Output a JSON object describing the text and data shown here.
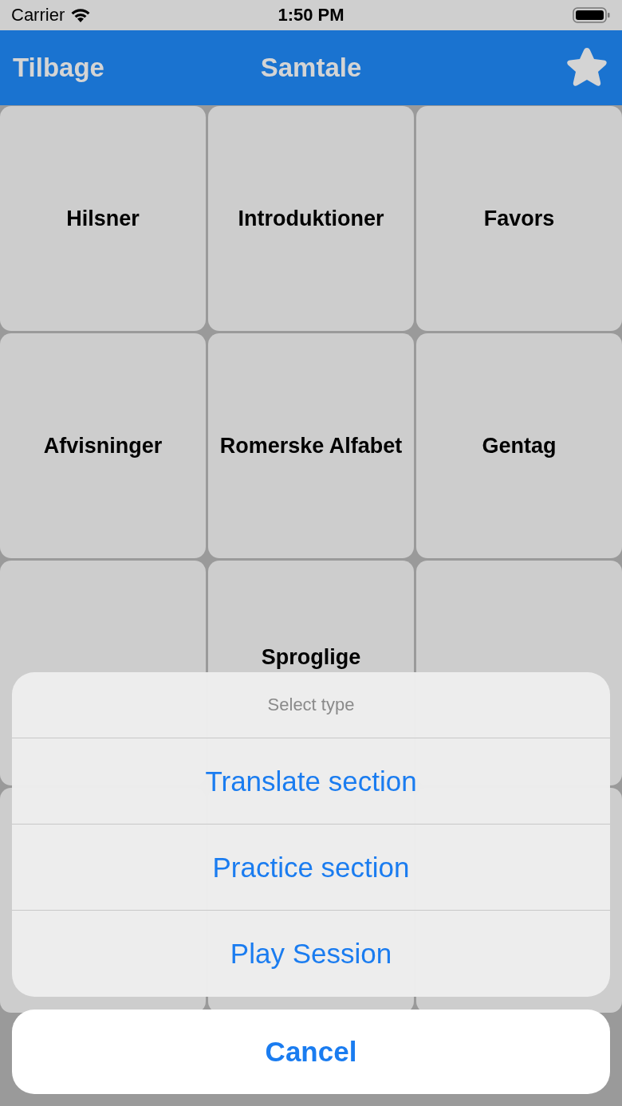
{
  "status_bar": {
    "carrier": "Carrier",
    "time": "1:50 PM"
  },
  "nav_bar": {
    "back": "Tilbage",
    "title": "Samtale"
  },
  "tiles": [
    {
      "kind": "text",
      "label": "Hilsner"
    },
    {
      "kind": "text",
      "label": "Introduktioner"
    },
    {
      "kind": "text",
      "label": "Favors"
    },
    {
      "kind": "text",
      "label": "Afvisninger"
    },
    {
      "kind": "text",
      "label": "Romerske Alfabet"
    },
    {
      "kind": "text",
      "label": "Gentag"
    },
    {
      "kind": "covered"
    },
    {
      "kind": "text",
      "label": "Sproglige",
      "continues_below": true
    },
    {
      "kind": "covered"
    },
    {
      "kind": "covered"
    },
    {
      "kind": "covered"
    },
    {
      "kind": "covered"
    }
  ],
  "action_sheet": {
    "title": "Select type",
    "actions": [
      "Translate section",
      "Practice section",
      "Play Session"
    ],
    "cancel": "Cancel"
  }
}
